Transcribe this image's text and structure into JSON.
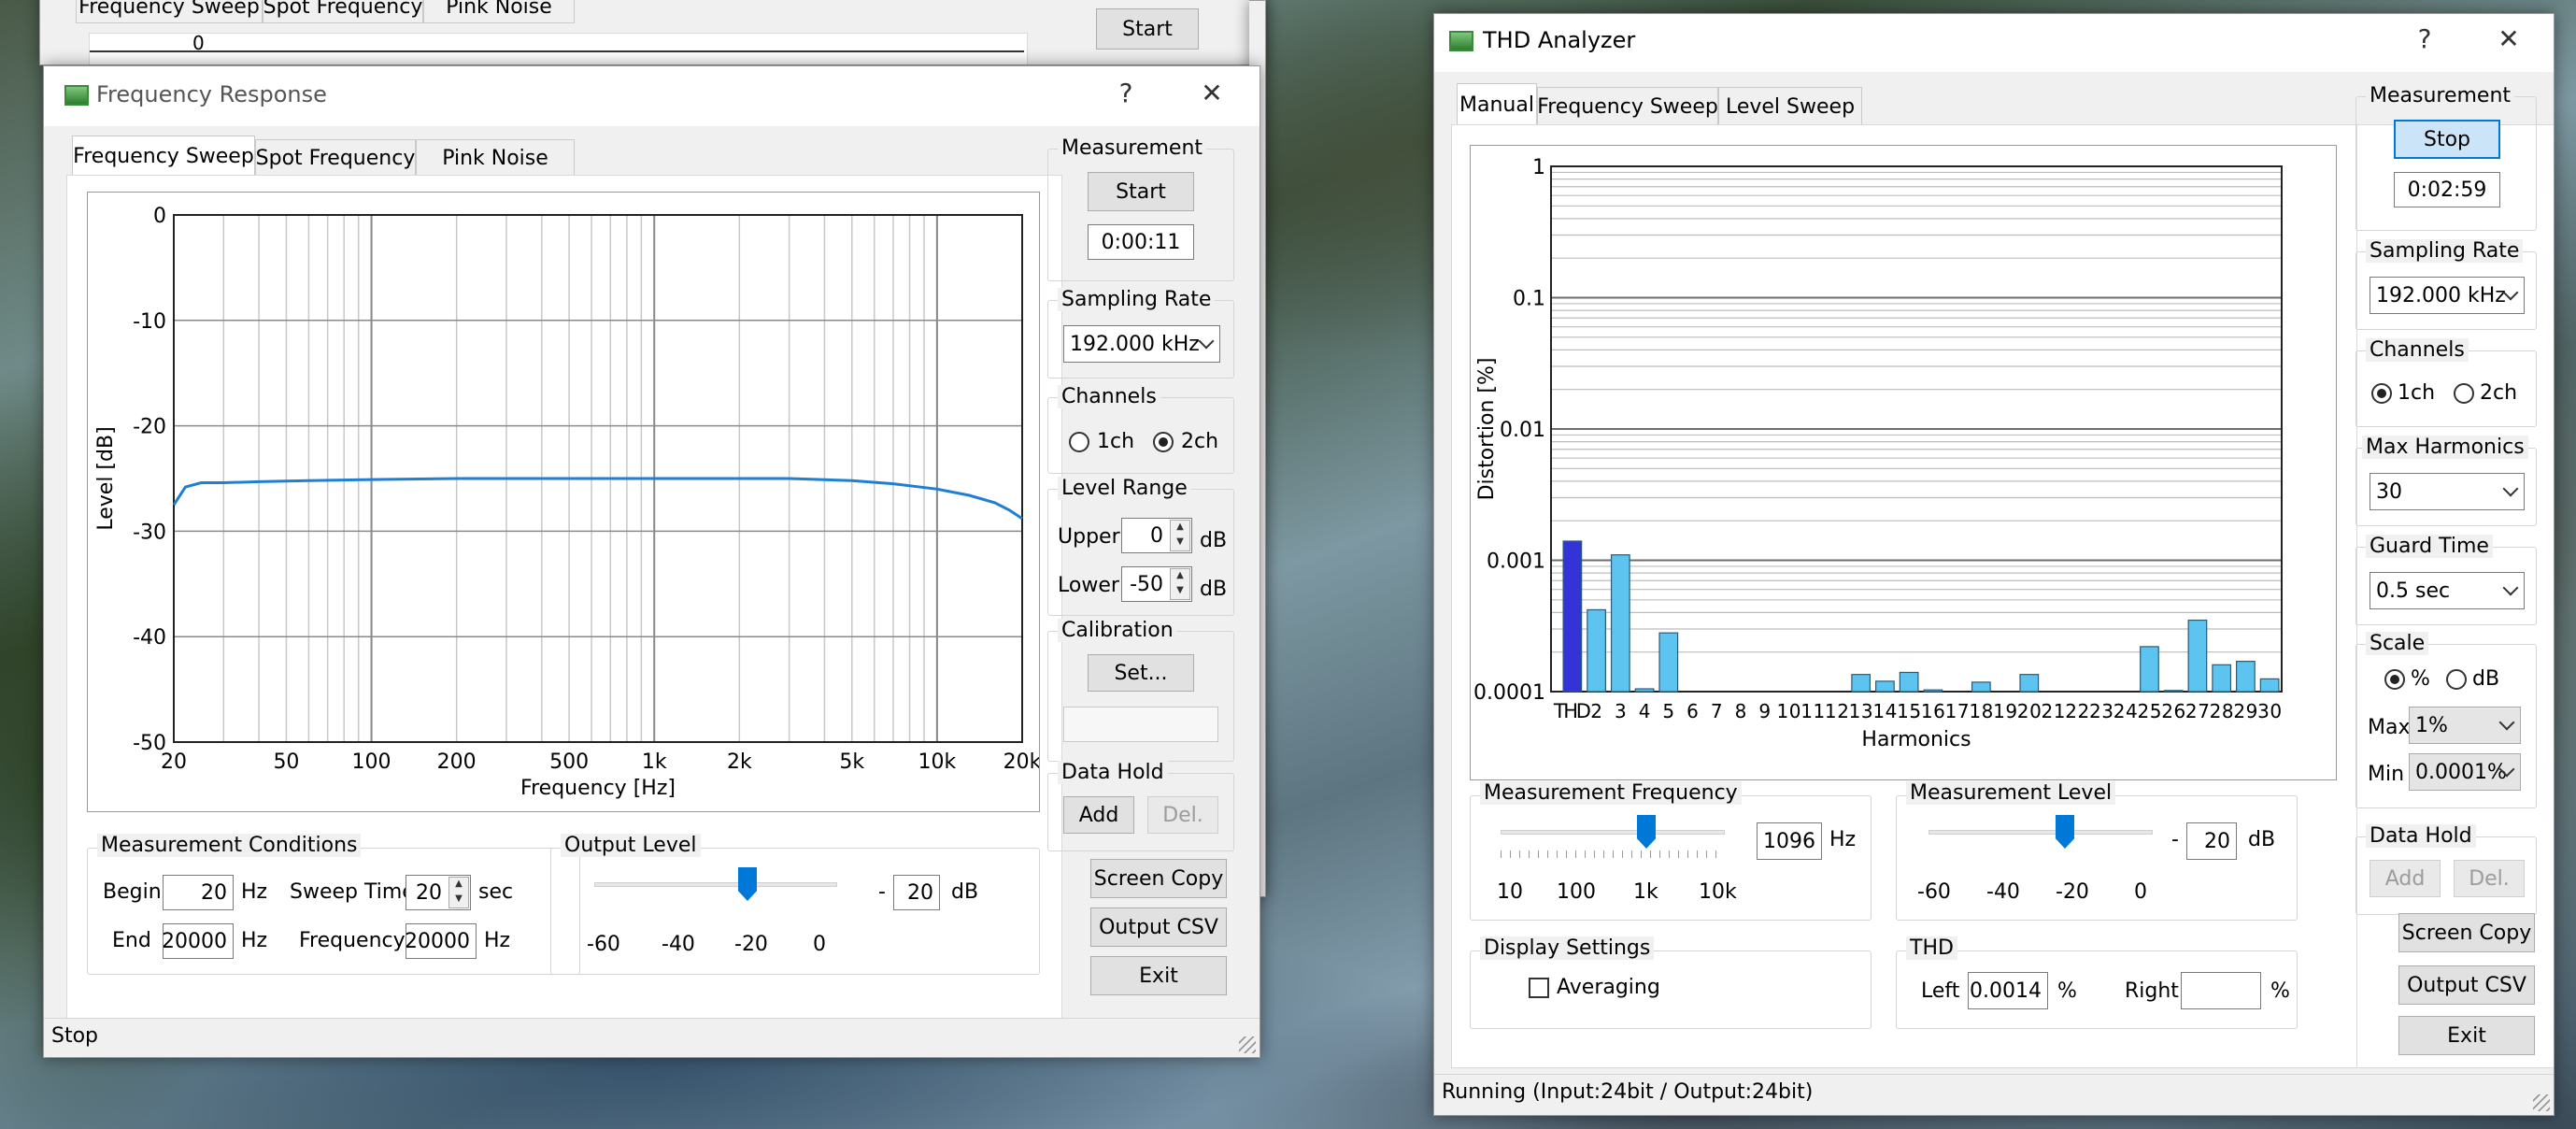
{
  "back_window": {
    "tabs": [
      "Frequency Sweep",
      "Spot Frequency",
      "Pink Noise"
    ],
    "start_label": "Start",
    "axis_top": "0"
  },
  "freq_window": {
    "title": "Frequency Response",
    "help": "?",
    "close": "✕",
    "tabs": [
      "Frequency Sweep",
      "Spot Frequency",
      "Pink Noise"
    ],
    "measurement": {
      "label": "Measurement",
      "button": "Start",
      "time": "0:00:11"
    },
    "sampling": {
      "label": "Sampling Rate",
      "value": "192.000 kHz"
    },
    "channels": {
      "label": "Channels",
      "opt1": "1ch",
      "opt2": "2ch",
      "selected": "2ch"
    },
    "level_range": {
      "label": "Level Range",
      "upper_label": "Upper",
      "upper": "0",
      "lower_label": "Lower",
      "lower": "-50",
      "unit": "dB"
    },
    "calibration": {
      "label": "Calibration",
      "button": "Set...",
      "value": ""
    },
    "data_hold": {
      "label": "Data Hold",
      "add": "Add",
      "del": "Del."
    },
    "screen_copy": "Screen Copy",
    "output_csv": "Output CSV",
    "exit": "Exit",
    "conditions": {
      "label": "Measurement Conditions",
      "begin_label": "Begin",
      "begin": "20",
      "begin_unit": "Hz",
      "sweep_label": "Sweep Time",
      "sweep": "20",
      "sweep_unit": "sec",
      "end_label": "End",
      "end": "20000",
      "end_unit": "Hz",
      "freq_label": "Frequency",
      "freq": "20000",
      "freq_unit": "Hz"
    },
    "output_level": {
      "label": "Output Level",
      "minus": "-",
      "value": "20",
      "unit": "dB",
      "scale": [
        "-60",
        "-40",
        "-20",
        "0"
      ],
      "level": -20
    },
    "status": "Stop"
  },
  "thd_window": {
    "title": "THD Analyzer",
    "help": "?",
    "close": "✕",
    "tabs": [
      "Manual",
      "Frequency Sweep",
      "Level Sweep"
    ],
    "measurement": {
      "label": "Measurement",
      "button": "Stop",
      "time": "0:02:59"
    },
    "sampling": {
      "label": "Sampling Rate",
      "value": "192.000 kHz"
    },
    "channels": {
      "label": "Channels",
      "opt1": "1ch",
      "opt2": "2ch",
      "selected": "1ch"
    },
    "max_harmonics": {
      "label": "Max Harmonics",
      "value": "30"
    },
    "guard_time": {
      "label": "Guard Time",
      "value": "0.5 sec"
    },
    "scale": {
      "label": "Scale",
      "opt1": "%",
      "opt2": "dB",
      "selected": "%",
      "max_label": "Max",
      "max": "1%",
      "min_label": "Min",
      "min": "0.0001%"
    },
    "data_hold": {
      "label": "Data Hold",
      "add": "Add",
      "del": "Del."
    },
    "screen_copy": "Screen Copy",
    "output_csv": "Output CSV",
    "exit": "Exit",
    "meas_freq": {
      "label": "Measurement Frequency",
      "value": "1096",
      "unit": "Hz",
      "scale": [
        "10",
        "100",
        "1k",
        "10k"
      ]
    },
    "meas_level": {
      "label": "Measurement Level",
      "minus": "-",
      "value": "20",
      "unit": "dB",
      "scale": [
        "-60",
        "-40",
        "-20",
        "0"
      ],
      "level": -20
    },
    "display": {
      "label": "Display Settings",
      "averaging": "Averaging"
    },
    "thd": {
      "label": "THD",
      "left_label": "Left",
      "left": "0.0014",
      "left_unit": "%",
      "right_label": "Right",
      "right": "",
      "right_unit": "%"
    },
    "status": "Running (Input:24bit / Output:24bit)"
  },
  "chart_data": [
    {
      "type": "line",
      "title": "",
      "xlabel": "Frequency [Hz]",
      "ylabel": "Level [dB]",
      "xscale": "log",
      "xlim": [
        20,
        20000
      ],
      "ylim": [
        -50,
        0
      ],
      "xticks": [
        "20",
        "50",
        "100",
        "200",
        "500",
        "1k",
        "2k",
        "5k",
        "10k",
        "20k"
      ],
      "xtick_values": [
        20,
        50,
        100,
        200,
        500,
        1000,
        2000,
        5000,
        10000,
        20000
      ],
      "yticks": [
        "0",
        "-10",
        "-20",
        "-30",
        "-40",
        "-50"
      ],
      "ytick_values": [
        0,
        -10,
        -20,
        -30,
        -40,
        -50
      ],
      "grid": true,
      "color": "#1e7fd4",
      "series": [
        {
          "x": [
            20,
            22,
            25,
            30,
            40,
            60,
            100,
            200,
            500,
            1000,
            2000,
            3000,
            5000,
            7000,
            10000,
            13000,
            16000,
            18000,
            20000
          ],
          "y": [
            -27.5,
            -25.8,
            -25.4,
            -25.4,
            -25.3,
            -25.2,
            -25.1,
            -25.0,
            -25.0,
            -25.0,
            -25.0,
            -25.0,
            -25.2,
            -25.5,
            -26.0,
            -26.6,
            -27.3,
            -28.0,
            -28.8
          ]
        }
      ]
    },
    {
      "type": "bar",
      "title": "",
      "xlabel": "Harmonics",
      "ylabel": "Distortion [%]",
      "yscale": "log",
      "ylim": [
        0.0001,
        1
      ],
      "yticks": [
        "1",
        "0.1",
        "0.01",
        "0.001",
        "0.0001"
      ],
      "ytick_values": [
        1,
        0.1,
        0.01,
        0.001,
        0.0001
      ],
      "categories": [
        "THD",
        "2",
        "3",
        "4",
        "5",
        "6",
        "7",
        "8",
        "9",
        "10",
        "11",
        "12",
        "13",
        "14",
        "15",
        "16",
        "17",
        "18",
        "19",
        "20",
        "21",
        "22",
        "23",
        "24",
        "25",
        "26",
        "27",
        "28",
        "29",
        "30"
      ],
      "values": [
        0.0014,
        0.00042,
        0.0011,
        0.000105,
        0.00028,
        0,
        0,
        0,
        0,
        0,
        0,
        0,
        0.000135,
        0.00012,
        0.00014,
        0.000103,
        0,
        0.000118,
        0,
        0.000135,
        0,
        0,
        0,
        0,
        0.00022,
        0.000102,
        0.00035,
        0.00016,
        0.00017,
        0.000125
      ],
      "colors": {
        "thd": "#3434d6",
        "harmonic": "#5cc4ef"
      },
      "grid": true
    }
  ]
}
